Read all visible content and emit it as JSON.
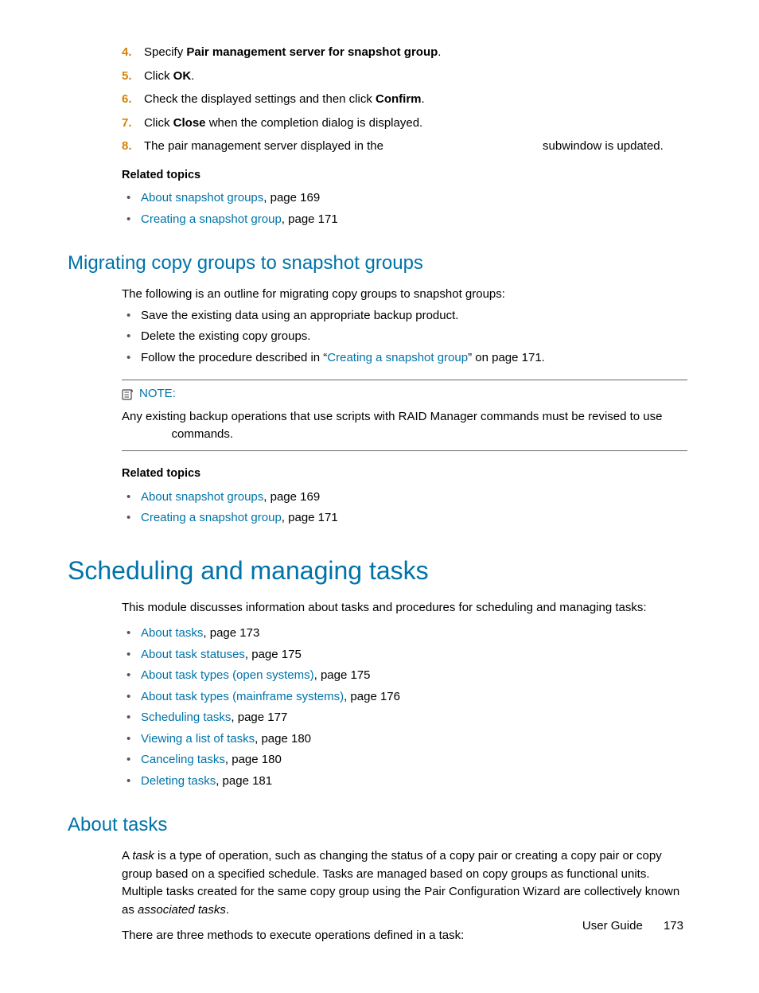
{
  "ordered": [
    {
      "num": "4.",
      "pre": "Specify ",
      "bold": "Pair management server for snapshot group",
      "post": "."
    },
    {
      "num": "5.",
      "pre": "Click ",
      "bold": "OK",
      "post": "."
    },
    {
      "num": "6.",
      "pre": "Check the displayed settings and then click ",
      "bold": "Confirm",
      "post": "."
    },
    {
      "num": "7.",
      "pre": "Click ",
      "bold": "Close",
      "post": " when the completion dialog is displayed."
    },
    {
      "num": "8.",
      "pre": "The pair management server displayed in the ",
      "bold": "",
      "post": "                                               subwindow is updated."
    }
  ],
  "relatedLabel": "Related topics",
  "related1": [
    {
      "link": "About snapshot groups",
      "rest": ", page 169"
    },
    {
      "link": "Creating a snapshot group",
      "rest": ", page 171"
    }
  ],
  "migrate": {
    "heading": "Migrating copy groups to snapshot groups",
    "intro": "The following is an outline for migrating copy groups to snapshot groups:",
    "items": {
      "a": "Save the existing data using an appropriate backup product.",
      "b": "Delete the existing copy groups.",
      "c_pre": "Follow the procedure described in “",
      "c_link": "Creating a snapshot group",
      "c_post": "” on page 171."
    }
  },
  "note": {
    "label": "NOTE:",
    "body_pre": "Any existing backup operations that use scripts with RAID Manager commands must be revised to use ",
    "body_gap": "               ",
    "body_post": "commands."
  },
  "related2": [
    {
      "link": "About snapshot groups",
      "rest": ", page 169"
    },
    {
      "link": "Creating a snapshot group",
      "rest": ", page 171"
    }
  ],
  "sched": {
    "heading": "Scheduling and managing tasks",
    "intro": "This module discusses information about tasks and procedures for scheduling and managing tasks:",
    "toc": [
      {
        "link": "About tasks",
        "rest": ", page 173"
      },
      {
        "link": "About task statuses",
        "rest": ", page 175"
      },
      {
        "link": "About task types (open systems)",
        "rest": ", page 175"
      },
      {
        "link": "About task types (mainframe systems)",
        "rest": ", page 176"
      },
      {
        "link": "Scheduling tasks",
        "rest": ", page 177"
      },
      {
        "link": "Viewing a list of tasks",
        "rest": ", page 180"
      },
      {
        "link": "Canceling tasks",
        "rest": ", page 180"
      },
      {
        "link": "Deleting tasks",
        "rest": ", page 181"
      }
    ]
  },
  "aboutTasks": {
    "heading": "About tasks",
    "p1_a": "A ",
    "p1_i1": "task",
    "p1_b": " is a type of operation, such as changing the status of a copy pair or creating a copy pair or copy group based on a specified schedule. Tasks are managed based on copy groups as functional units. Multiple tasks created for the same copy group using the Pair Configuration Wizard are collectively known as ",
    "p1_i2": "associated tasks",
    "p1_c": ".",
    "p2": "There are three methods to execute operations defined in a task:"
  },
  "footer": {
    "label": "User Guide",
    "page": "173"
  }
}
